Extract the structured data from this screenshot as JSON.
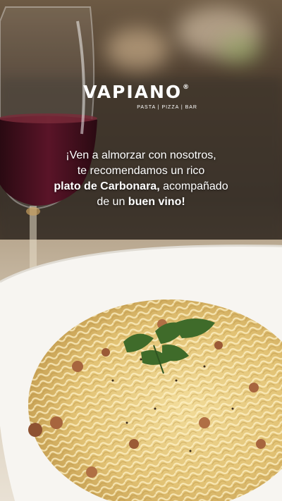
{
  "brand": {
    "name": "VAPIANO",
    "registered_mark": "®",
    "tagline": "PASTA | PIZZA | BAR"
  },
  "message": {
    "line1": "¡Ven a almorzar con nosotros,",
    "line2": "te recomendamos un rico",
    "line3_bold": "plato de Carbonara,",
    "line3_rest": " acompañado",
    "line4_start": "de un ",
    "line4_bold": "buen vino!"
  },
  "photo": {
    "subjects": [
      "wine-glass",
      "carbonara-plate",
      "parsley-garnish"
    ]
  }
}
